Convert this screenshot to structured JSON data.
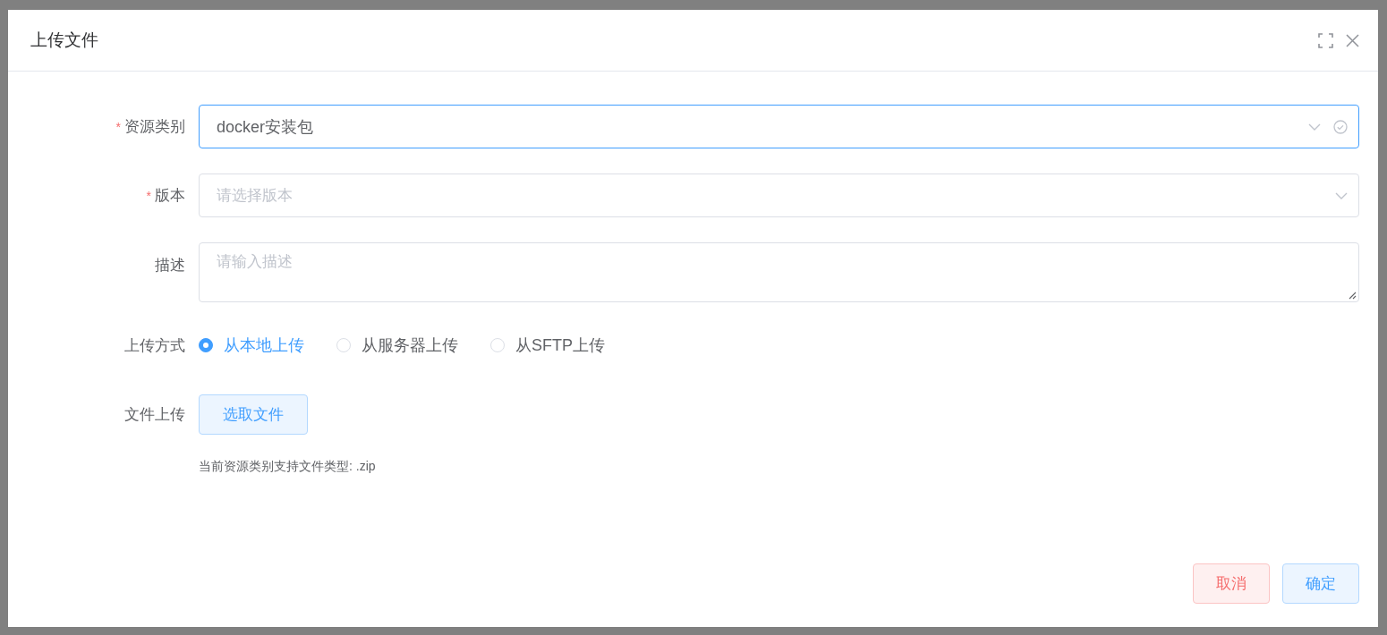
{
  "dialog": {
    "title": "上传文件"
  },
  "form": {
    "fields": [
      {
        "kind": "select",
        "label": "资源类别",
        "required_mark": "*",
        "value": "docker安装包",
        "focused": true
      },
      {
        "kind": "select",
        "label": "版本",
        "required_mark": "*",
        "placeholder": "请选择版本",
        "focused": false
      },
      {
        "kind": "textarea",
        "label": "描述",
        "placeholder": "请输入描述"
      },
      {
        "kind": "radio",
        "label": "上传方式",
        "options": [
          {
            "label": "从本地上传",
            "selected": true
          },
          {
            "label": "从服务器上传",
            "selected": false
          },
          {
            "label": "从SFTP上传",
            "selected": false
          }
        ]
      },
      {
        "kind": "upload",
        "label": "文件上传",
        "button": "选取文件",
        "hint": "当前资源类别支持文件类型: .zip"
      }
    ]
  },
  "buttons": [
    {
      "kind": "cancel",
      "label": "取消"
    },
    {
      "kind": "confirm",
      "label": "确定"
    }
  ]
}
